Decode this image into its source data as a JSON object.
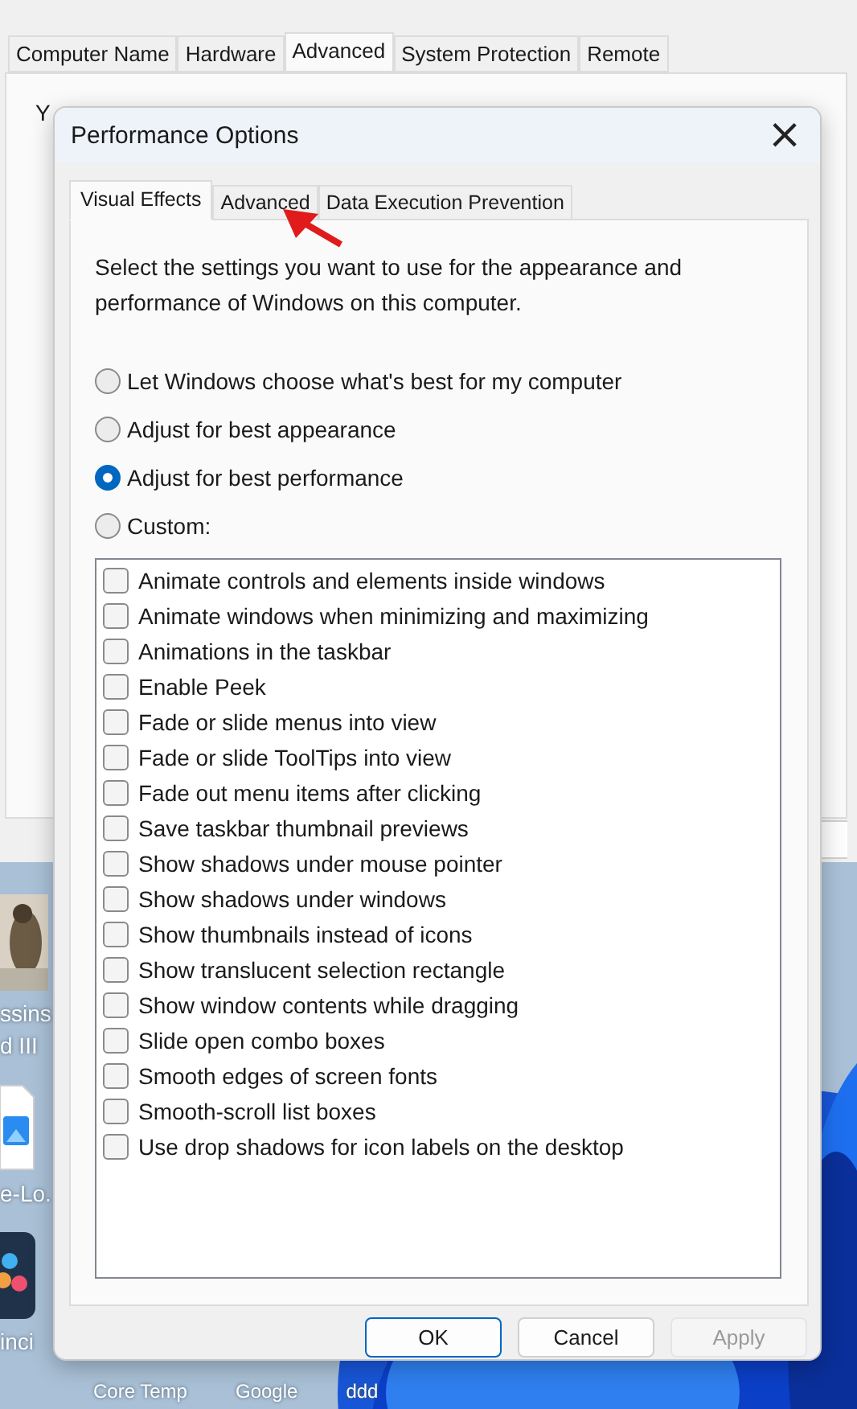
{
  "background_window": {
    "tabs": [
      {
        "label": "Computer Name",
        "selected": false
      },
      {
        "label": "Hardware",
        "selected": false
      },
      {
        "label": "Advanced",
        "selected": true
      },
      {
        "label": "System Protection",
        "selected": false
      },
      {
        "label": "Remote",
        "selected": false
      }
    ],
    "partial_texts": [
      "Y"
    ]
  },
  "desktop": {
    "icons": [
      {
        "kind": "picture",
        "label": "ssins\nd III"
      },
      {
        "kind": "file",
        "label": "e-Lo."
      },
      {
        "kind": "app",
        "label": "inci"
      }
    ],
    "shortcuts": [
      {
        "label": "Core Temp"
      },
      {
        "label": "Google"
      },
      {
        "label": "ddd"
      }
    ]
  },
  "dialog": {
    "title": "Performance Options",
    "close": "×",
    "tabs": [
      {
        "label": "Visual Effects",
        "selected": true
      },
      {
        "label": "Advanced",
        "selected": false
      },
      {
        "label": "Data Execution Prevention",
        "selected": false
      }
    ],
    "description": "Select the settings you want to use for the appearance and performance of Windows on this computer.",
    "options": [
      {
        "label": "Let Windows choose what's best for my computer",
        "selected": false
      },
      {
        "label": "Adjust for best appearance",
        "selected": false
      },
      {
        "label": "Adjust for best performance",
        "selected": true
      },
      {
        "label": "Custom:",
        "selected": false
      }
    ],
    "effects": [
      {
        "label": "Animate controls and elements inside windows",
        "checked": false
      },
      {
        "label": "Animate windows when minimizing and maximizing",
        "checked": false
      },
      {
        "label": "Animations in the taskbar",
        "checked": false
      },
      {
        "label": "Enable Peek",
        "checked": false
      },
      {
        "label": "Fade or slide menus into view",
        "checked": false
      },
      {
        "label": "Fade or slide ToolTips into view",
        "checked": false
      },
      {
        "label": "Fade out menu items after clicking",
        "checked": false
      },
      {
        "label": "Save taskbar thumbnail previews",
        "checked": false
      },
      {
        "label": "Show shadows under mouse pointer",
        "checked": false
      },
      {
        "label": "Show shadows under windows",
        "checked": false
      },
      {
        "label": "Show thumbnails instead of icons",
        "checked": false
      },
      {
        "label": "Show translucent selection rectangle",
        "checked": false
      },
      {
        "label": "Show window contents while dragging",
        "checked": false
      },
      {
        "label": "Slide open combo boxes",
        "checked": false
      },
      {
        "label": "Smooth edges of screen fonts",
        "checked": false
      },
      {
        "label": "Smooth-scroll list boxes",
        "checked": false
      },
      {
        "label": "Use drop shadows for icon labels on the desktop",
        "checked": false
      }
    ],
    "buttons": [
      {
        "label": "OK",
        "default": true,
        "disabled": false
      },
      {
        "label": "Cancel",
        "default": false,
        "disabled": false
      },
      {
        "label": "Apply",
        "default": false,
        "disabled": true
      }
    ]
  }
}
